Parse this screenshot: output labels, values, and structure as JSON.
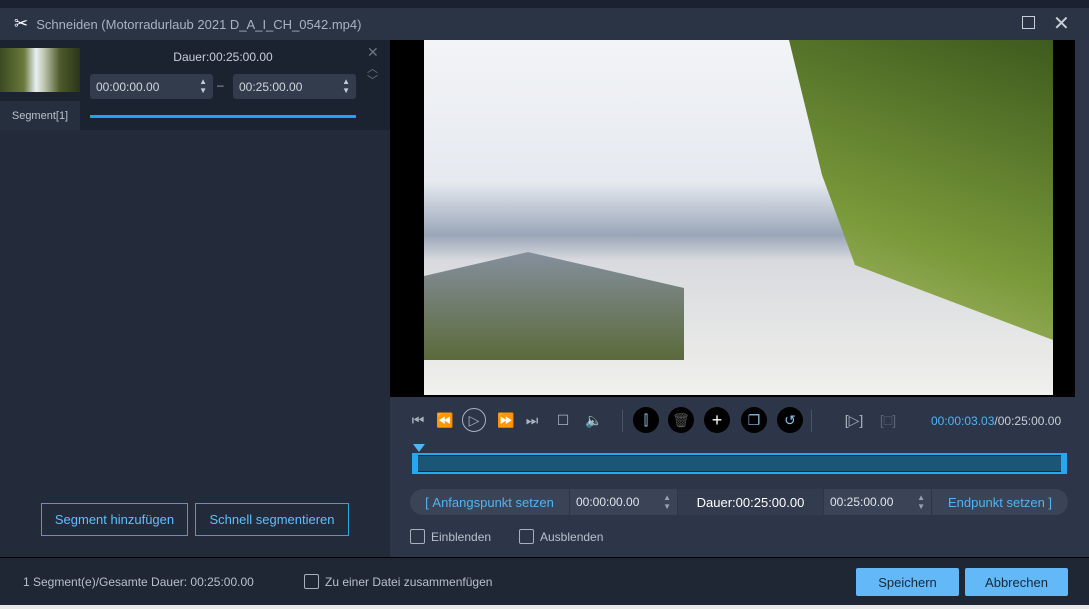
{
  "window": {
    "title": "Schneiden (Motorradurlaub 2021 D_A_I_CH_0542.mp4)"
  },
  "segment": {
    "label": "Segment[1]",
    "duration": "Dauer:00:25:00.00",
    "start": "00:00:00.00",
    "end": "00:25:00.00",
    "separator": "–"
  },
  "left_buttons": {
    "add": "Segment hinzufügen",
    "quick": "Schnell segmentieren"
  },
  "player": {
    "current_time": "00:00:03.03",
    "total_time": "/00:25:00.00",
    "progress_percent": 0.2
  },
  "trim": {
    "set_start": "Anfangspunkt setzen",
    "start": "00:00:00.00",
    "duration": "Dauer:00:25:00.00",
    "end": "00:25:00.00",
    "set_end": "Endpunkt setzen"
  },
  "fade": {
    "fade_in": "Einblenden",
    "fade_out": "Ausblenden"
  },
  "footer": {
    "summary": "1 Segment(e)/Gesamte Dauer: 00:25:00.00",
    "merge": "Zu einer Datei zusammenfügen",
    "save": "Speichern",
    "cancel": "Abbrechen"
  }
}
